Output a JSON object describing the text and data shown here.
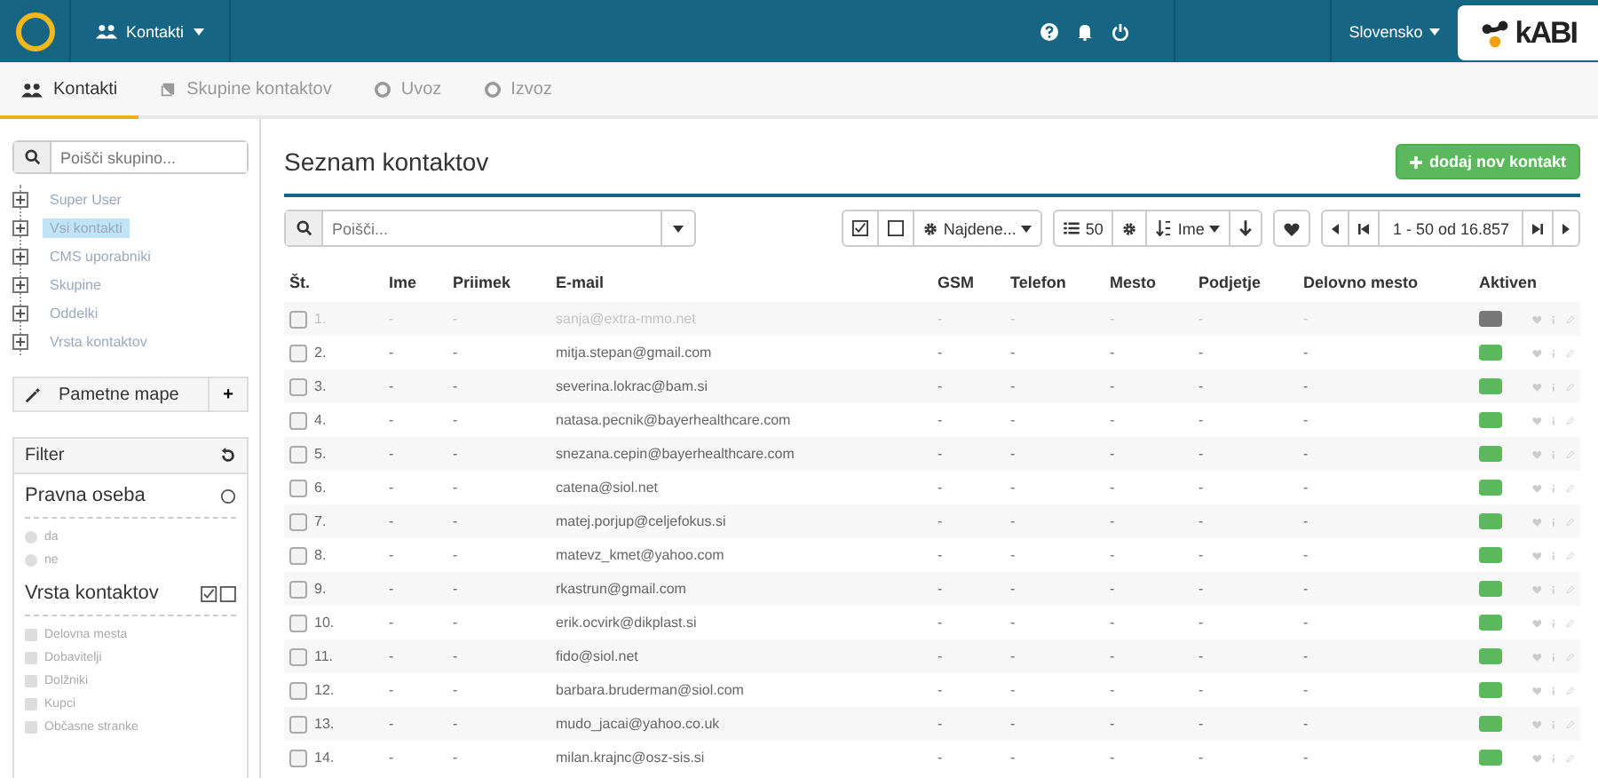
{
  "topbar": {
    "module": "Kontakti",
    "language": "Slovensko",
    "logo_text": "kABI"
  },
  "tabs": [
    {
      "label": "Kontakti",
      "selected": true
    },
    {
      "label": "Skupine kontaktov",
      "selected": false
    },
    {
      "label": "Uvoz",
      "selected": false
    },
    {
      "label": "Izvoz",
      "selected": false
    }
  ],
  "sidebar": {
    "group_search": {
      "placeholder": "Poišči skupino..."
    },
    "tree": [
      {
        "label": "Super User",
        "selected": false
      },
      {
        "label": "Vsi kontakti",
        "selected": true
      },
      {
        "label": "CMS uporabniki",
        "selected": false
      },
      {
        "label": "Skupine",
        "selected": false
      },
      {
        "label": "Oddelki",
        "selected": false
      },
      {
        "label": "Vrsta kontaktov",
        "selected": false
      }
    ],
    "smart_folders": {
      "title": "Pametne mape",
      "add": "+"
    },
    "filter": {
      "title": "Filter",
      "sections": [
        {
          "title": "Pravna oseba",
          "kind": "radio",
          "options": [
            {
              "label": "da",
              "checked": false
            },
            {
              "label": "ne",
              "checked": false
            }
          ]
        },
        {
          "title": "Vrsta kontaktov",
          "kind": "checkbox",
          "options": [
            {
              "label": "Delovna mesta",
              "checked": false
            },
            {
              "label": "Dobavitelji",
              "checked": false
            },
            {
              "label": "Dolžniki",
              "checked": false
            },
            {
              "label": "Kupci",
              "checked": false
            },
            {
              "label": "Občasne stranke",
              "checked": false
            }
          ]
        }
      ]
    }
  },
  "main": {
    "title": "Seznam kontaktov",
    "add_button": "dodaj nov kontakt",
    "search": {
      "placeholder": "Poišči..."
    },
    "toolbar": {
      "found": "Najdene...",
      "page_size": "50",
      "sort": "Ime",
      "pagination": "1 - 50 od 16.857"
    },
    "table": {
      "columns": [
        "Št.",
        "Ime",
        "Priimek",
        "E-mail",
        "GSM",
        "Telefon",
        "Mesto",
        "Podjetje",
        "Delovno mesto",
        "Aktiven"
      ],
      "rows": [
        {
          "cells": [
            "1.",
            "-",
            "-",
            "sanja@extra-mmo.net",
            "-",
            "-",
            "-",
            "-",
            "-"
          ],
          "active": false,
          "checked": false
        },
        {
          "cells": [
            "2.",
            "-",
            "-",
            "mitja.stepan@gmail.com",
            "-",
            "-",
            "-",
            "-",
            "-"
          ],
          "active": true,
          "checked": false
        },
        {
          "cells": [
            "3.",
            "-",
            "-",
            "severina.lokrac@bam.si",
            "-",
            "-",
            "-",
            "-",
            "-"
          ],
          "active": true,
          "checked": false
        },
        {
          "cells": [
            "4.",
            "-",
            "-",
            "natasa.pecnik@bayerhealthcare.com",
            "-",
            "-",
            "-",
            "-",
            "-"
          ],
          "active": true,
          "checked": false
        },
        {
          "cells": [
            "5.",
            "-",
            "-",
            "snezana.cepin@bayerhealthcare.com",
            "-",
            "-",
            "-",
            "-",
            "-"
          ],
          "active": true,
          "checked": false
        },
        {
          "cells": [
            "6.",
            "-",
            "-",
            "catena@siol.net",
            "-",
            "-",
            "-",
            "-",
            "-"
          ],
          "active": true,
          "checked": false
        },
        {
          "cells": [
            "7.",
            "-",
            "-",
            "matej.porjup@celjefokus.si",
            "-",
            "-",
            "-",
            "-",
            "-"
          ],
          "active": true,
          "checked": false
        },
        {
          "cells": [
            "8.",
            "-",
            "-",
            "matevz_kmet@yahoo.com",
            "-",
            "-",
            "-",
            "-",
            "-"
          ],
          "active": true,
          "checked": false
        },
        {
          "cells": [
            "9.",
            "-",
            "-",
            "rkastrun@gmail.com",
            "-",
            "-",
            "-",
            "-",
            "-"
          ],
          "active": true,
          "checked": false
        },
        {
          "cells": [
            "10.",
            "-",
            "-",
            "erik.ocvirk@dikplast.si",
            "-",
            "-",
            "-",
            "-",
            "-"
          ],
          "active": true,
          "checked": false
        },
        {
          "cells": [
            "11.",
            "-",
            "-",
            "fido@siol.net",
            "-",
            "-",
            "-",
            "-",
            "-"
          ],
          "active": true,
          "checked": false
        },
        {
          "cells": [
            "12.",
            "-",
            "-",
            "barbara.bruderman@siol.com",
            "-",
            "-",
            "-",
            "-",
            "-"
          ],
          "active": true,
          "checked": false
        },
        {
          "cells": [
            "13.",
            "-",
            "-",
            "mudo_jacai@yahoo.co.uk",
            "-",
            "-",
            "-",
            "-",
            "-"
          ],
          "active": true,
          "checked": false
        },
        {
          "cells": [
            "14.",
            "-",
            "-",
            "milan.krajnc@osz-sis.si",
            "-",
            "-",
            "-",
            "-",
            "-"
          ],
          "active": true,
          "checked": false
        }
      ]
    }
  }
}
